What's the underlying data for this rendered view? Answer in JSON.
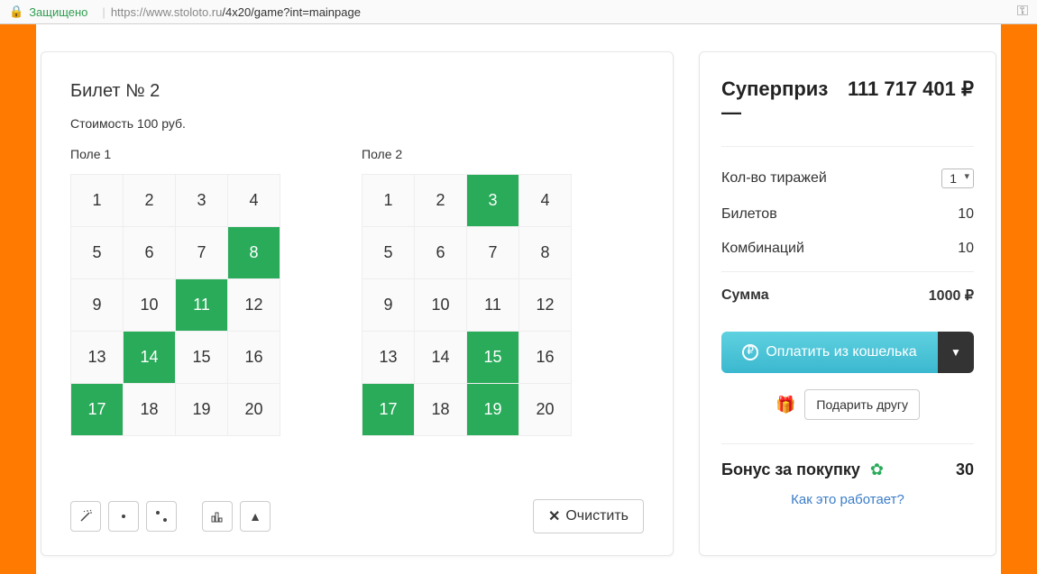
{
  "urlbar": {
    "secure_label": "Защищено",
    "url_host": "https://www.stoloto.ru",
    "url_path": "/4x20/game?int=mainpage"
  },
  "ticket": {
    "title": "Билет № 2",
    "cost_label": "Стоимость 100 руб.",
    "field1_label": "Поле 1",
    "field2_label": "Поле 2",
    "numbers": [
      1,
      2,
      3,
      4,
      5,
      6,
      7,
      8,
      9,
      10,
      11,
      12,
      13,
      14,
      15,
      16,
      17,
      18,
      19,
      20
    ],
    "field1_selected": [
      8,
      11,
      14,
      17
    ],
    "field2_selected": [
      3,
      15,
      17,
      19
    ],
    "clear_label": "Очистить"
  },
  "side": {
    "prize_label": "Суперприз —",
    "prize_amount": "111 717 401 ₽",
    "draws_label": "Кол-во тиражей",
    "draws_value": "1",
    "tickets_label": "Билетов",
    "tickets_value": "10",
    "combos_label": "Комбинаций",
    "combos_value": "10",
    "total_label": "Сумма",
    "total_value": "1000 ₽",
    "pay_label": "Оплатить из кошелька",
    "gift_label": "Подарить другу",
    "bonus_label": "Бонус за покупку",
    "bonus_value": "30",
    "how_link": "Как это работает?"
  }
}
